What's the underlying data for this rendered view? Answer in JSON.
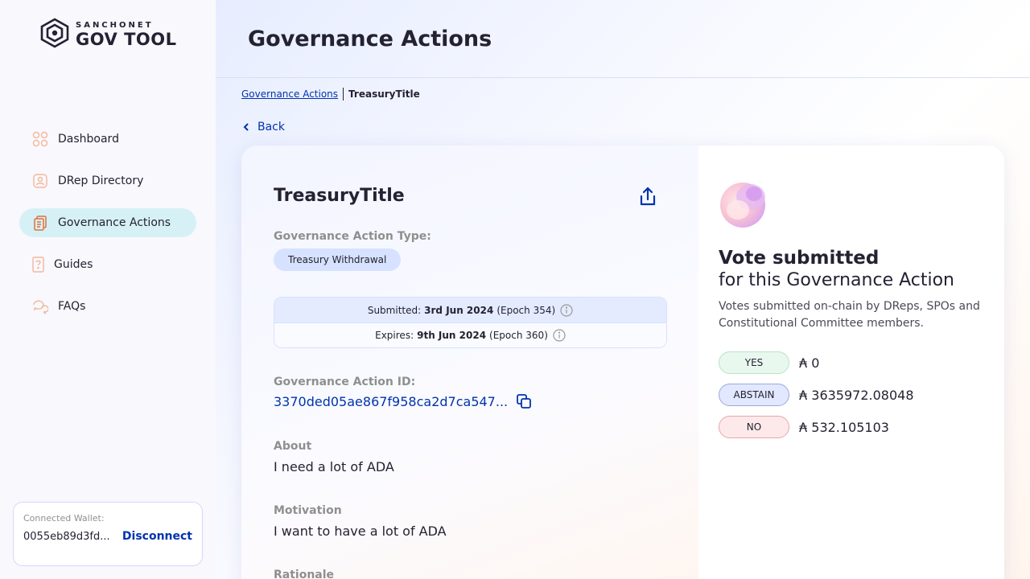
{
  "colors": {
    "accent": "#0033ad",
    "active_nav_bg": "#d6f1f6",
    "yes_bg": "#e9f8ee",
    "abstain_bg": "#e2e8ff",
    "no_bg": "#fde9ea"
  },
  "sidebar": {
    "logo": {
      "sub": "SANCHONET",
      "main": "GOV TOOL"
    },
    "items": [
      {
        "label": "Dashboard",
        "icon": "dashboard-icon"
      },
      {
        "label": "DRep Directory",
        "icon": "drep-directory-icon"
      },
      {
        "label": "Governance Actions",
        "icon": "governance-actions-icon",
        "active": true
      },
      {
        "label": "Guides",
        "icon": "guides-icon"
      },
      {
        "label": "FAQs",
        "icon": "faqs-icon"
      }
    ],
    "wallet": {
      "label": "Connected Wallet:",
      "address": "0055eb89d3fd...",
      "disconnect": "Disconnect"
    }
  },
  "header": {
    "title": "Governance Actions"
  },
  "breadcrumb": {
    "link": "Governance Actions",
    "current": "TreasuryTitle"
  },
  "back_label": "Back",
  "action": {
    "title": "TreasuryTitle",
    "type_label": "Governance Action Type:",
    "type_value": "Treasury Withdrawal",
    "submitted": {
      "label": "Submitted:",
      "date": "3rd Jun 2024",
      "epoch": "(Epoch 354)"
    },
    "expires": {
      "label": "Expires:",
      "date": "9th Jun 2024",
      "epoch": "(Epoch 360)"
    },
    "id_label": "Governance Action ID:",
    "id_value": "3370ded05ae867f958ca2d7ca547...",
    "about_label": "About",
    "about_value": "I need a lot of ADA",
    "motivation_label": "Motivation",
    "motivation_value": "I want to have a lot of ADA",
    "rationale_label": "Rationale"
  },
  "vote": {
    "title": "Vote submitted",
    "subtitle": "for this Governance Action",
    "description": "Votes submitted on-chain by DReps, SPOs and Constitutional Committee members.",
    "rows": [
      {
        "label": "YES",
        "value": "₳ 0"
      },
      {
        "label": "ABSTAIN",
        "value": "₳ 3635972.08048"
      },
      {
        "label": "NO",
        "value": "₳ 532.105103"
      }
    ]
  }
}
